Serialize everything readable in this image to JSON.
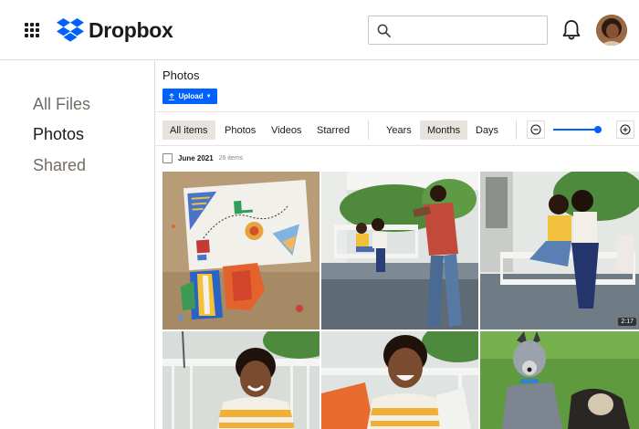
{
  "header": {
    "logo_text": "Dropbox",
    "search_placeholder": "",
    "colors": {
      "brand": "#0061fe"
    }
  },
  "sidebar": {
    "items": [
      {
        "label": "All Files",
        "active": false
      },
      {
        "label": "Photos",
        "active": true
      },
      {
        "label": "Shared",
        "active": false
      }
    ]
  },
  "main": {
    "title": "Photos",
    "upload_label": "Upload",
    "filters": [
      {
        "label": "All items",
        "selected": true
      },
      {
        "label": "Photos",
        "selected": false
      },
      {
        "label": "Videos",
        "selected": false
      },
      {
        "label": "Starred",
        "selected": false
      }
    ],
    "views": [
      {
        "label": "Years",
        "selected": false
      },
      {
        "label": "Months",
        "selected": true
      },
      {
        "label": "Days",
        "selected": false
      }
    ],
    "zoom_level": 0.95,
    "group": {
      "title": "June 2021",
      "count": "26 items"
    },
    "photos": [
      {
        "subject": "collage artwork"
      },
      {
        "subject": "man photographing mother and son on porch swing"
      },
      {
        "subject": "mother and son on porch swing",
        "duration": "2:17"
      },
      {
        "subject": "boy smiling on porch swing"
      },
      {
        "subject": "boy laughing holding paper"
      },
      {
        "subject": "two dogs on grass"
      }
    ]
  }
}
